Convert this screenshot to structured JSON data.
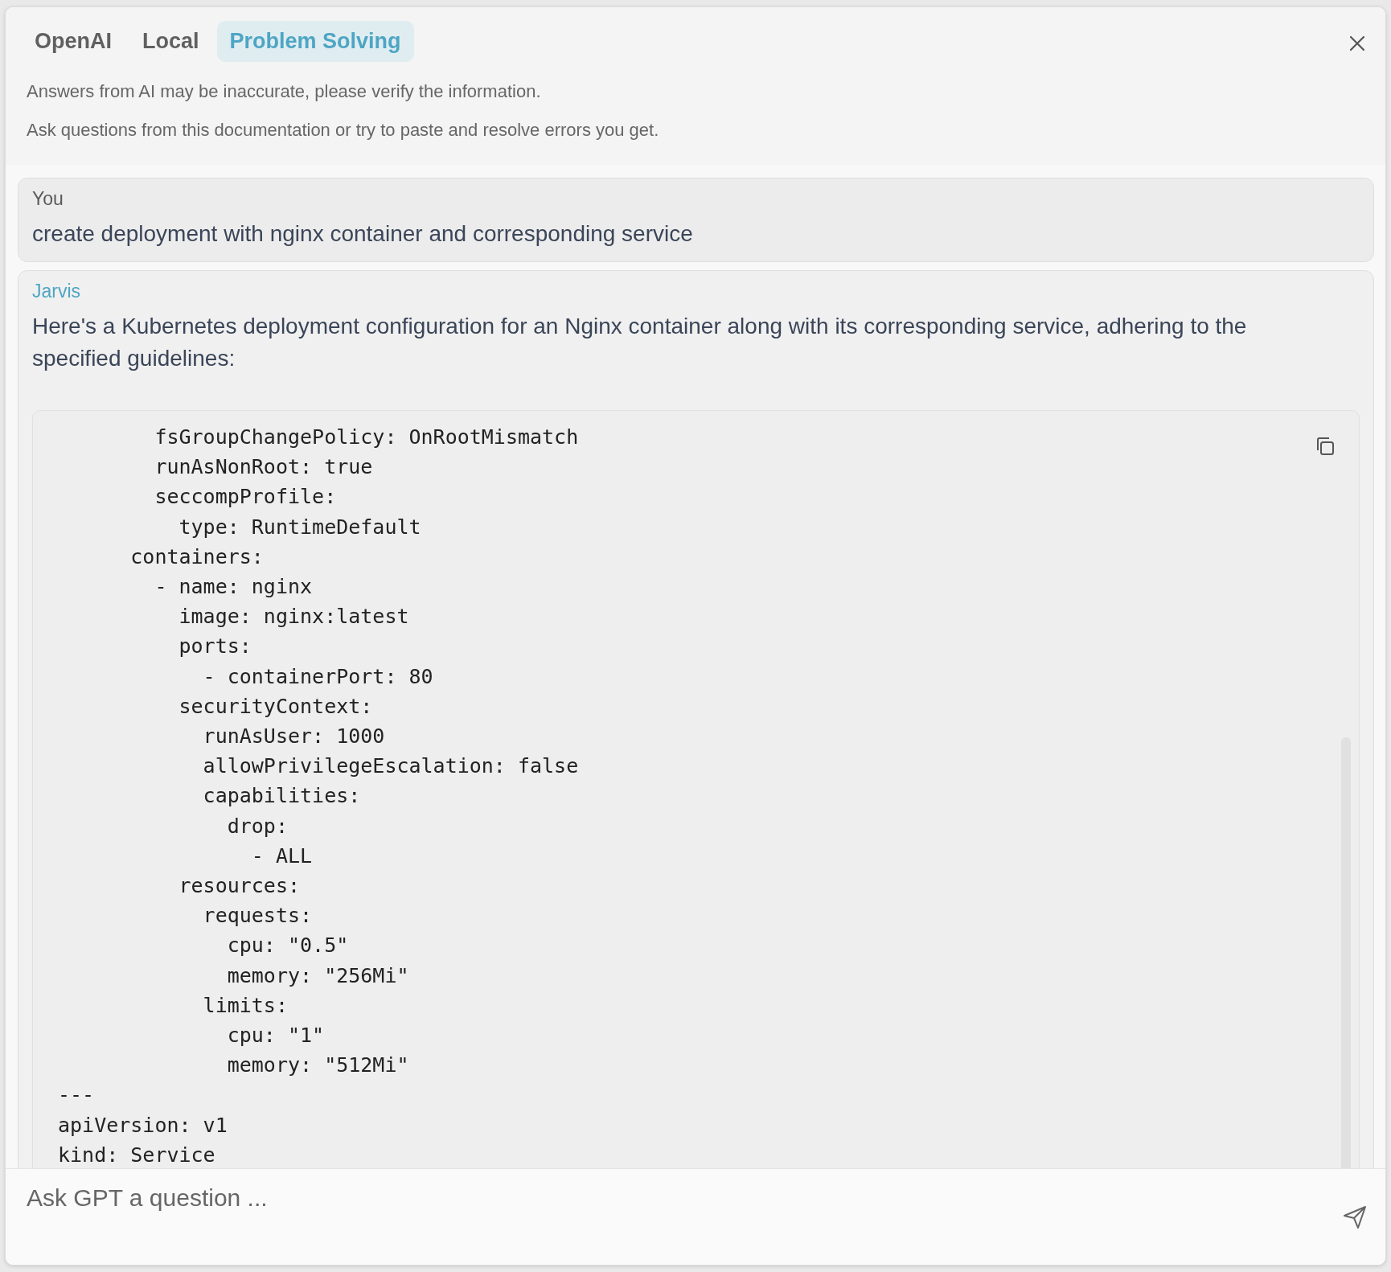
{
  "tabs": [
    {
      "label": "OpenAI",
      "selected": false
    },
    {
      "label": "Local",
      "selected": false
    },
    {
      "label": "Problem Solving",
      "selected": true
    }
  ],
  "notices": [
    "Answers from AI may be inaccurate, please verify the information.",
    "Ask questions from this documentation or try to paste and resolve errors you get."
  ],
  "messages": [
    {
      "kind": "user",
      "author": "You",
      "text": "create deployment with nginx container and corresponding service"
    },
    {
      "kind": "assistant",
      "author": "Jarvis",
      "text": "Here's a Kubernetes deployment configuration for an Nginx container along with its corresponding service, adhering to the specified guidelines:",
      "code_lines": [
        "        fsGroupChangePolicy: OnRootMismatch",
        "        runAsNonRoot: true",
        "        seccompProfile:",
        "          type: RuntimeDefault",
        "      containers:",
        "        - name: nginx",
        "          image: nginx:latest",
        "          ports:",
        "            - containerPort: 80",
        "          securityContext:",
        "            runAsUser: 1000",
        "            allowPrivilegeEscalation: false",
        "            capabilities:",
        "              drop:",
        "                - ALL",
        "          resources:",
        "            requests:",
        "              cpu: \"0.5\"",
        "              memory: \"256Mi\"",
        "            limits:",
        "              cpu: \"1\"",
        "              memory: \"512Mi\"",
        "---",
        "apiVersion: v1",
        "kind: Service"
      ]
    }
  ],
  "input": {
    "placeholder": "Ask GPT a question ..."
  }
}
